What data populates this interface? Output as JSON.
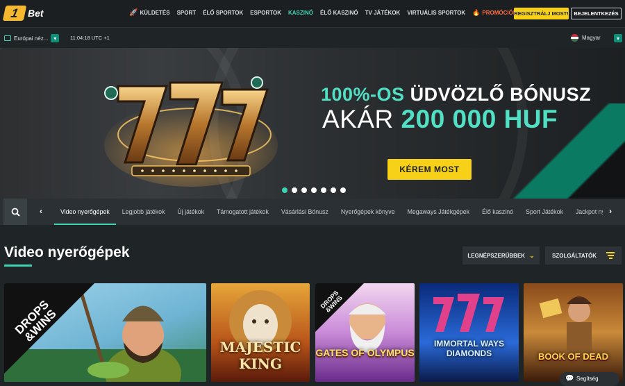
{
  "header": {
    "logo_mark": "1",
    "logo_text": "Bet",
    "menu": [
      {
        "label": "KÜLDETÉS",
        "icon": "rocket-icon"
      },
      {
        "label": "SPORT"
      },
      {
        "label": "ÉLŐ SPORTOK"
      },
      {
        "label": "ESPORTOK"
      },
      {
        "label": "KASZINÓ",
        "active": true
      },
      {
        "label": "ÉLŐ KASZINÓ"
      },
      {
        "label": "TV JÁTÉKOK"
      },
      {
        "label": "VIRTUÁLIS SPORTOK"
      },
      {
        "label": "PROMÓCIÓK",
        "icon": "fire-icon"
      }
    ],
    "register_label": "REGISZTRÁLJ MOST!",
    "login_label": "BEJELENTKEZÉS"
  },
  "subbar": {
    "odds_format": "Európai néz...",
    "clock": "11:04:18 UTC +1",
    "language": "Magyar"
  },
  "banner": {
    "title_accent": "100%-OS",
    "title_rest": "ÜDVÖZLŐ BÓNUSZ",
    "sub_prefix": "AKÁR",
    "sub_accent": "200 000 HUF",
    "cta": "KÉREM MOST",
    "slide_count": 7,
    "active_slide": 0
  },
  "categories": [
    "Video nyerőgépek",
    "Legjobb játékok",
    "Új játékok",
    "Támogatott játékok",
    "Vásárlási Bónusz",
    "Nyerőgépek könyve",
    "Megaways Játékgépek",
    "Élő kaszinó",
    "Sport Játékok",
    "Jackpot nyer"
  ],
  "section": {
    "title": "Video nyerőgépek",
    "sort_label": "LEGNÉPSZERŰBBEK",
    "providers_label": "SZOLGÁLTATÓK"
  },
  "games": [
    {
      "name": "",
      "badge": "DROPS & WINS"
    },
    {
      "name": "MAJESTIC KING"
    },
    {
      "name": "GATES OF OLYMPUS",
      "badge": "DROPS & WINS"
    },
    {
      "name": "IMMORTAL WAYS DIAMONDS"
    },
    {
      "name": "BOOK OF DEAD"
    }
  ],
  "drops_line1": "DROPS",
  "drops_line2": "&WINS",
  "colors": {
    "accent": "#3ed3b4",
    "cta": "#f7d117",
    "promo": "#ff6a3d",
    "background": "#1f2426"
  },
  "chat_label": "Segítség"
}
